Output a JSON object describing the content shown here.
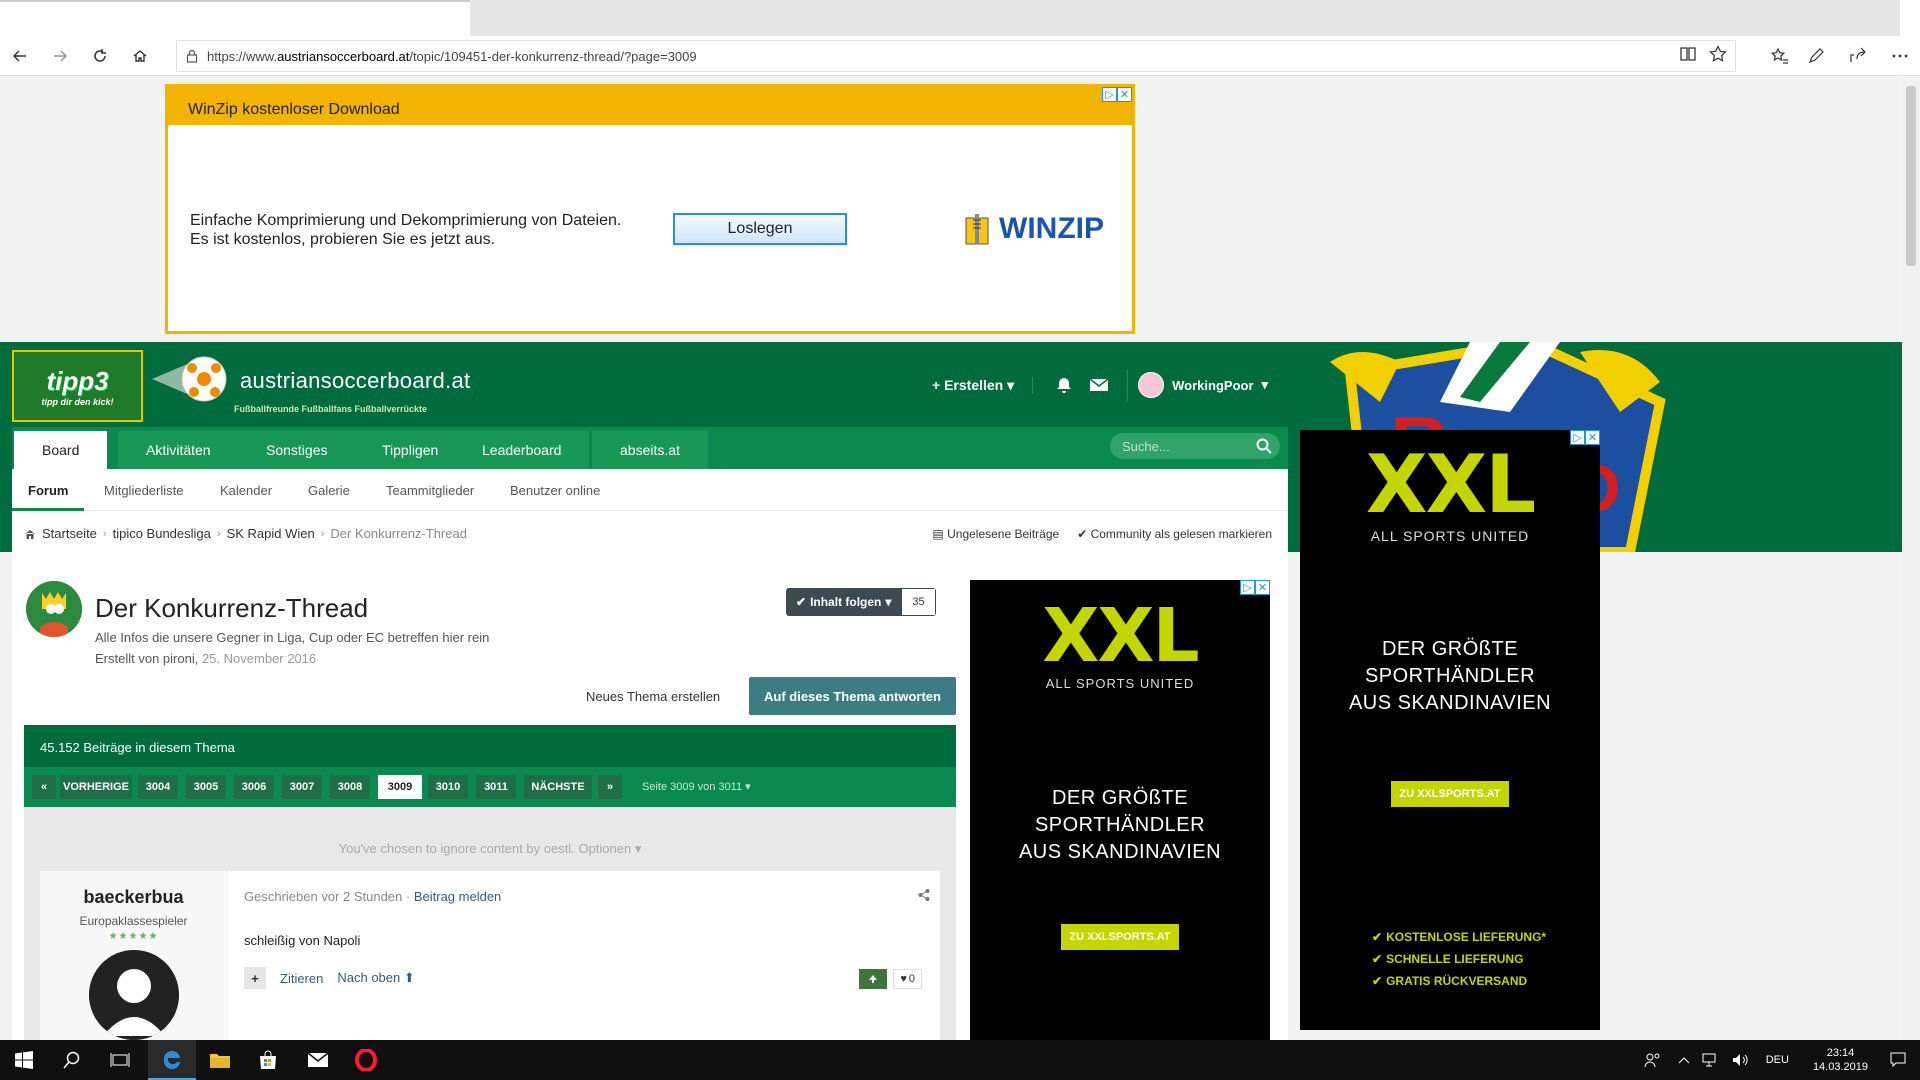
{
  "browser": {
    "url_prefix": "https://www.",
    "url_host": "austriansoccerboard.at",
    "url_path": "/topic/109451-der-konkurrenz-thread/?page=3009"
  },
  "top_ad": {
    "title": "WinZip kostenloser Download",
    "line1": "Einfache Komprimierung und Dekomprimierung von Dateien.",
    "line2": "Es ist kostenlos, probieren Sie es jetzt aus.",
    "button": "Loslegen",
    "brand": "WINZIP"
  },
  "site": {
    "tipp3_big": "tipp3",
    "tipp3_small": "tipp dir den kick!",
    "brand_name": "austriansoccerboard.at",
    "brand_tag": "Fußballfreunde  Fußballfans  Fußballverrückte",
    "create_label": "Erstellen",
    "username": "WorkingPoor",
    "search_placeholder": "Suche..."
  },
  "primary_nav": [
    "Board",
    "Aktivitäten",
    "Sonstiges",
    "Tippligen",
    "Leaderboard",
    "abseits.at"
  ],
  "secondary_nav": [
    "Forum",
    "Mitgliederliste",
    "Kalender",
    "Galerie",
    "Teammitglieder",
    "Benutzer online"
  ],
  "breadcrumb": {
    "items": [
      "Startseite",
      "tipico Bundesliga",
      "SK Rapid Wien",
      "Der Konkurrenz-Thread"
    ],
    "unread": "Ungelesene Beiträge",
    "mark_read": "Community als gelesen markieren"
  },
  "topic": {
    "title": "Der Konkurrenz-Thread",
    "description": "Alle Infos die unsere Gegner in Liga, Cup oder EC betreffen hier rein",
    "created_by_prefix": "Erstellt von pironi,",
    "created_date": "25. November 2016",
    "follow_label": "Inhalt folgen",
    "follow_count": "35",
    "new_topic": "Neues Thema erstellen",
    "reply": "Auf dieses Thema antworten",
    "post_count": "45.152 Beiträge in diesem Thema"
  },
  "pager": {
    "prev": "VORHERIGE",
    "pages": [
      "3004",
      "3005",
      "3006",
      "3007",
      "3008",
      "3009",
      "3010",
      "3011"
    ],
    "current": "3009",
    "next": "NÄCHSTE",
    "of_label": "Seite 3009 von 3011"
  },
  "ignore_note": "You've chosen to ignore content by oestl.",
  "ignore_options": "Optionen",
  "post": {
    "author": "baeckerbua",
    "rank": "Europaklassespieler",
    "stars": "★★★★★",
    "written": "Geschrieben vor 2 Stunden",
    "report": "Beitrag melden",
    "body": "schleißig von Napoli",
    "quote": "Zitieren",
    "to_top": "Nach oben",
    "likes": "0"
  },
  "xxl_ad": {
    "logo": "XXL",
    "sub": "ALL SPORTS UNITED",
    "claim": [
      "DER GRÖßTE",
      "SPORTHÄNDLER",
      "AUS SKANDINAVIEN"
    ],
    "cta": "ZU XXLSPORTS.AT",
    "checks": [
      "KOSTENLOSE LIEFERUNG*",
      "SCHNELLE LIEFERUNG",
      "GRATIS RÜCKVERSAND"
    ]
  },
  "taskbar": {
    "lang": "DEU",
    "time": "23:14",
    "date": "14.03.2019"
  },
  "colors": {
    "brand_green": "#006b3c",
    "nav_green": "#0b8a4f",
    "reply_button": "#3b7d83",
    "xxl_lime": "#c3d600",
    "winzip_yellow": "#f2b400"
  }
}
